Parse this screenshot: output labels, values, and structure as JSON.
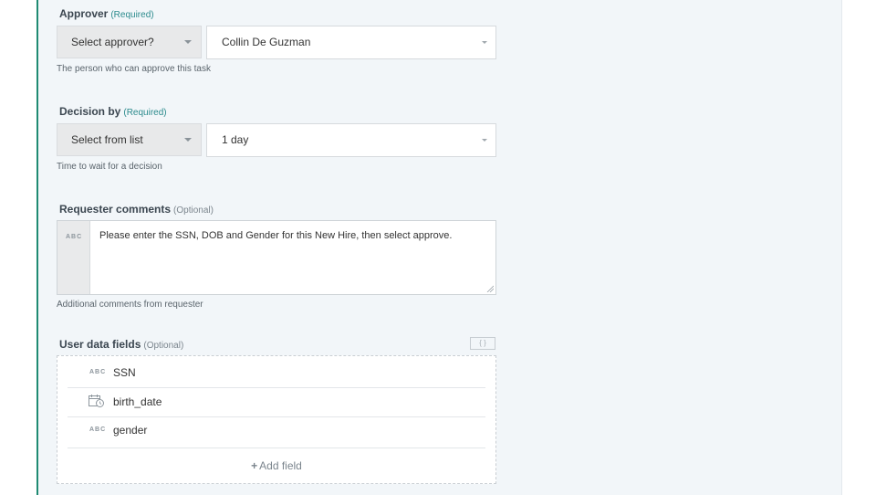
{
  "approver": {
    "label": "Approver",
    "required_tag": "(Required)",
    "mode_select": "Select approver?",
    "value": "Collin De Guzman",
    "hint": "The person who can approve this task"
  },
  "decision_by": {
    "label": "Decision by",
    "required_tag": "(Required)",
    "mode_select": "Select from list",
    "value": "1 day",
    "hint": "Time to wait for a decision"
  },
  "requester_comments": {
    "label": "Requester comments",
    "optional_tag": "(Optional)",
    "type_badge": "ABC",
    "value": "Please enter the SSN, DOB and Gender for this New Hire, then select approve.",
    "hint": "Additional comments from requester"
  },
  "user_data_fields": {
    "label": "User data fields",
    "optional_tag": "(Optional)",
    "formula_button": "{ }",
    "fields": [
      {
        "type": "text",
        "type_badge": "ABC",
        "name": "SSN",
        "icon": "text-type-icon"
      },
      {
        "type": "date",
        "type_badge": "",
        "name": "birth_date",
        "icon": "calendar-icon"
      },
      {
        "type": "text",
        "type_badge": "ABC",
        "name": "gender",
        "icon": "text-type-icon"
      }
    ],
    "add_field_label": "Add field",
    "add_field_icon": "+"
  },
  "colors": {
    "accent": "#1f8a72",
    "required": "#2a8a8c",
    "panel_bg": "#f2f6f9"
  }
}
